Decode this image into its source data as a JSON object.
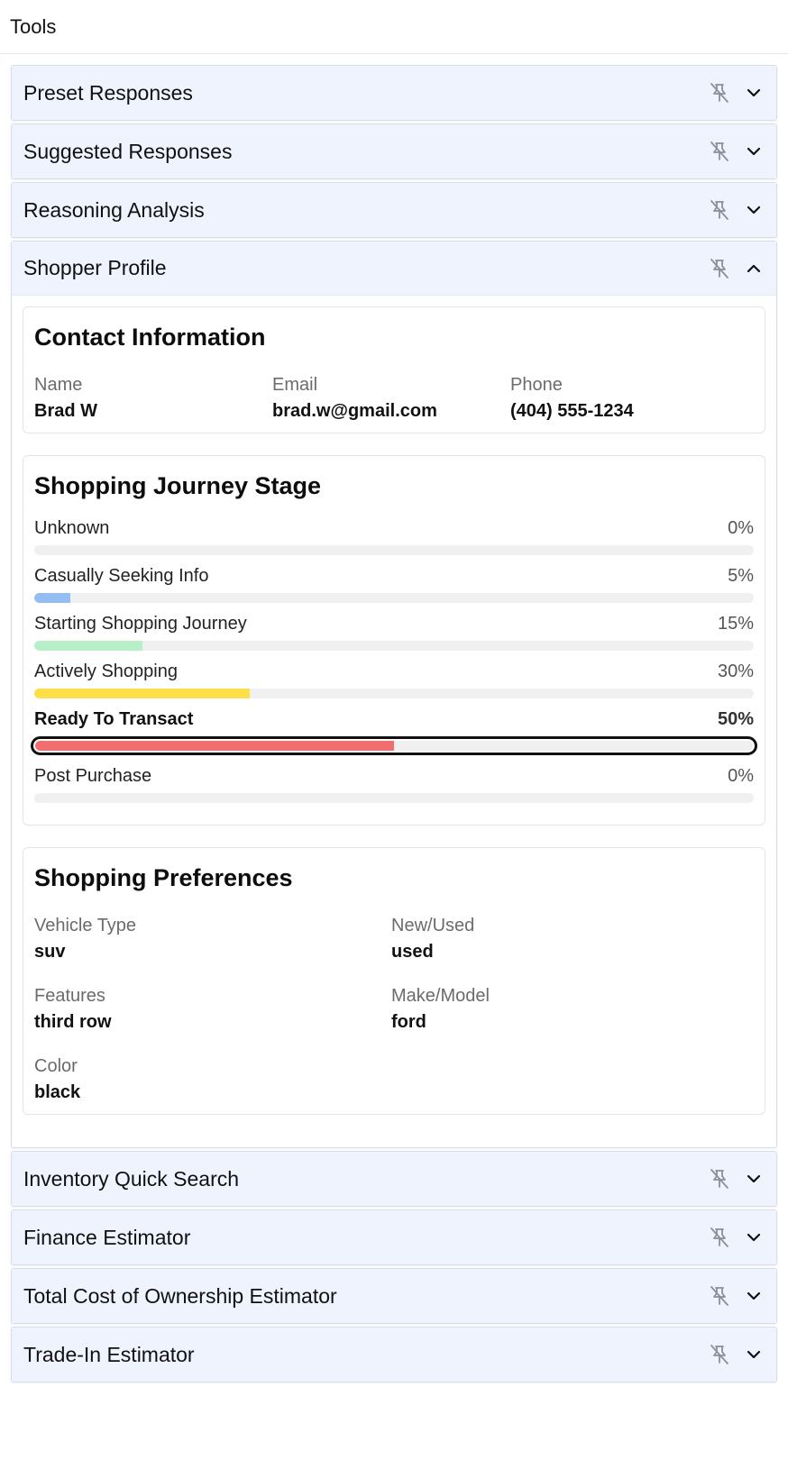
{
  "header": {
    "title": "Tools"
  },
  "panels_before": [
    {
      "title": "Preset Responses"
    },
    {
      "title": "Suggested Responses"
    },
    {
      "title": "Reasoning Analysis"
    }
  ],
  "profile": {
    "title": "Shopper Profile",
    "contact": {
      "title": "Contact Information",
      "name_label": "Name",
      "name_value": "Brad W",
      "email_label": "Email",
      "email_value": "brad.w@gmail.com",
      "phone_label": "Phone",
      "phone_value": "(404) 555-1234"
    },
    "journey": {
      "title": "Shopping Journey Stage",
      "stages": [
        {
          "label": "Unknown",
          "pct": "0%",
          "value": 0,
          "color": "#a8c8f5"
        },
        {
          "label": "Casually Seeking Info",
          "pct": "5%",
          "value": 5,
          "color": "#93bdf3"
        },
        {
          "label": "Starting Shopping Journey",
          "pct": "15%",
          "value": 15,
          "color": "#b7f0c8"
        },
        {
          "label": "Actively Shopping",
          "pct": "30%",
          "value": 30,
          "color": "#fde047"
        },
        {
          "label": "Ready To Transact",
          "pct": "50%",
          "value": 50,
          "color": "#f26d6d"
        },
        {
          "label": "Post Purchase",
          "pct": "0%",
          "value": 0,
          "color": "#c4b5fd"
        }
      ],
      "active_stage": "Ready To Transact"
    },
    "preferences": {
      "title": "Shopping Preferences",
      "vehicle_type_label": "Vehicle Type",
      "vehicle_type_value": "suv",
      "new_used_label": "New/Used",
      "new_used_value": "used",
      "features_label": "Features",
      "features_value": "third row",
      "make_model_label": "Make/Model",
      "make_model_value": "ford",
      "color_label": "Color",
      "color_value": "black"
    }
  },
  "panels_after": [
    {
      "title": "Inventory Quick Search"
    },
    {
      "title": "Finance Estimator"
    },
    {
      "title": "Total Cost of Ownership Estimator"
    },
    {
      "title": "Trade-In Estimator"
    }
  ],
  "icons": {
    "pin": "pin-off-icon",
    "expand": "chevron-down-icon",
    "collapse": "chevron-up-icon"
  }
}
